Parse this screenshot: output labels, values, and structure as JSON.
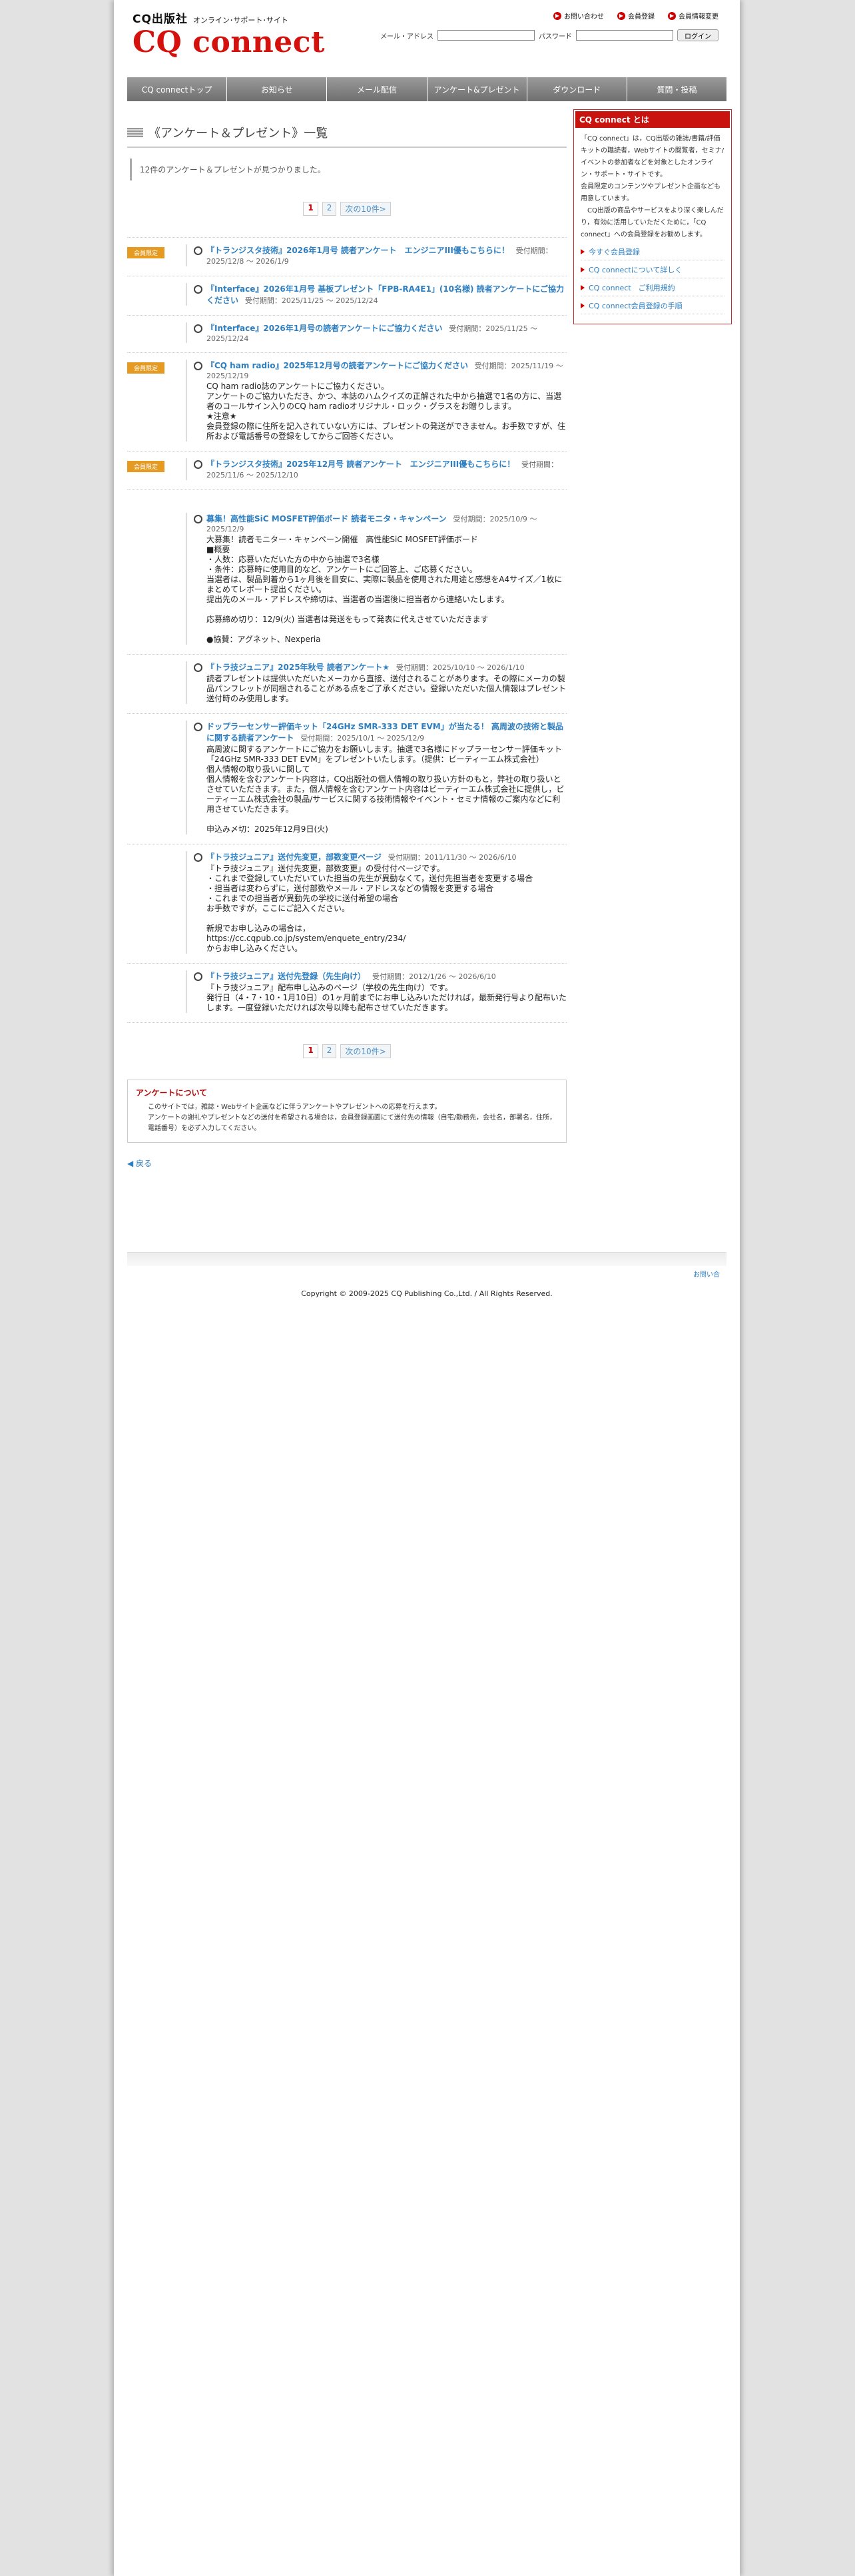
{
  "header": {
    "publisher": "CQ出版社",
    "subtitle": "オンライン･サポート･サイト",
    "logo": "CQ connect",
    "toplinks": [
      {
        "label": "お問い合わせ"
      },
      {
        "label": "会員登録"
      },
      {
        "label": "会員情報変更"
      }
    ],
    "login": {
      "email_label": "メール・アドレス",
      "password_label": "パスワード",
      "button_label": "ログイン"
    }
  },
  "nav": [
    {
      "label": "CQ connectトップ"
    },
    {
      "label": "お知らせ"
    },
    {
      "label": "メール配信"
    },
    {
      "label": "アンケート&プレゼント"
    },
    {
      "label": "ダウンロード"
    },
    {
      "label": "質問・投稿"
    }
  ],
  "page": {
    "title": "《アンケート＆プレゼント》一覧",
    "found_text": "12件のアンケート＆プレゼントが見つかりました。",
    "pager": {
      "current": "1",
      "other": "2",
      "next": "次の10件>"
    },
    "items": [
      {
        "badge": "会員限定",
        "title": "『トランジスタ技術』2026年1月号 読者アンケート　エンジニアIII優もこちらに！",
        "period": "受付期間：2025/12/8 ～ 2026/1/9",
        "desc": ""
      },
      {
        "badge": "",
        "title": "『Interface』2026年1月号 基板プレゼント「FPB-RA4E1」(10名様) 読者アンケートにご協力ください",
        "period": "受付期間：2025/11/25 ～ 2025/12/24",
        "desc": ""
      },
      {
        "badge": "",
        "title": "『Interface』2026年1月号の読者アンケートにご協力ください",
        "period": "受付期間：2025/11/25 ～ 2025/12/24",
        "desc": ""
      },
      {
        "badge": "会員限定",
        "title": "『CQ ham radio』2025年12月号の読者アンケートにご協力ください",
        "period": "受付期間：2025/11/19 ～ 2025/12/19",
        "desc": "CQ ham radio誌のアンケートにご協力ください。\nアンケートのご協力いただき、かつ、本誌のハムクイズの正解された中から抽選で1名の方に、当選者のコールサイン入りのCQ ham radioオリジナル・ロック・グラスをお贈りします。\n★注意★\n会員登録の際に住所を記入されていない方には、プレゼントの発送ができません。お手数ですが、住所および電話番号の登録をしてからご回答ください。"
      },
      {
        "badge": "会員限定",
        "title": "『トランジスタ技術』2025年12月号 読者アンケート　エンジニアIII優もこちらに！",
        "period": "受付期間：2025/11/6 ～ 2025/12/10",
        "desc": ""
      },
      {
        "badge": "",
        "title": "募集！高性能SiC MOSFET評価ボード 読者モニタ・キャンペーン",
        "period": "受付期間：2025/10/9 ～ 2025/12/9",
        "desc": "大募集！読者モニター・キャンペーン開催　高性能SiC MOSFET評価ボード\n■概要\n・人数：応募いただいた方の中から抽選で3名様\n・条件：応募時に使用目的など、アンケートにご回答上、ご応募ください。\n当選者は、製品到着から1ヶ月後を目安に、実際に製品を使用された用途と感想をA4サイズ／1枚にまとめてレポート提出ください。\n提出先のメール・アドレスや締切は、当選者の当選後に担当者から連絡いたします。\n\n応募締め切り：12/9(火) 当選者は発送をもって発表に代えさせていただきます\n\n●協賛：アグネット、Nexperia"
      },
      {
        "badge": "",
        "title": "『トラ技ジュニア』2025年秋号 読者アンケート★",
        "period": "受付期間：2025/10/10 ～ 2026/1/10",
        "desc": "読者プレゼントは提供いただいたメーカから直接、送付されることがあります。その際にメーカの製品パンフレットが同梱されることがある点をご了承ください。登録いただいた個人情報はプレゼント送付時のみ使用します。"
      },
      {
        "badge": "",
        "title": "ドップラーセンサー評価キット「24GHz SMR-333 DET EVM」が当たる！ 高周波の技術と製品に関する読者アンケート",
        "period": "受付期間：2025/10/1 ～ 2025/12/9",
        "desc": "高周波に関するアンケートにご協力をお願いします。抽選で3名様にドップラーセンサー評価キット「24GHz SMR-333 DET EVM」をプレゼントいたします。（提供：ビーティーエム株式会社）\n個人情報の取り扱いに関して\n個人情報を含むアンケート内容は，CQ出版社の個人情報の取り扱い方針のもと，弊社の取り扱いとさせていただきます。また，個人情報を含むアンケート内容はビーティーエム株式会社に提供し，ビーティーエム株式会社の製品/サービスに関する技術情報やイベント・セミナ情報のご案内などに利用させていただきます。\n\n申込み〆切：2025年12月9日(火)"
      },
      {
        "badge": "",
        "title": "『トラ技ジュニア』送付先変更，部数変更ページ",
        "period": "受付期間：2011/11/30 ～ 2026/6/10",
        "desc": "『トラ技ジュニア』送付先変更，部数変更」の受付付ページです。\n・これまで登録していただいていた担当の先生が異動なくて，送付先担当者を変更する場合\n・担当者は変わらずに，送付部数やメール・アドレスなどの情報を変更する場合\n・これまでの担当者が異動先の学校に送付希望の場合\nお手数ですが，ここにご記入ください。\n\n新規でお申し込みの場合は，\nhttps://cc.cqpub.co.jp/system/enquete_entry/234/\nからお申し込みください。"
      },
      {
        "badge": "",
        "title": "『トラ技ジュニア』送付先登録（先生向け）",
        "period": "受付期間：2012/1/26 ～ 2026/6/10",
        "desc": "『トラ技ジュニア』配布申し込みのページ（学校の先生向け）です。\n発行日（4・7・10・1月10日）の1ヶ月前までにお申し込みいただければ，最新発行号より配布いたします。一度登録いただければ次号以降も配布させていただきます。"
      }
    ],
    "about": {
      "heading": "アンケートについて",
      "lines": "このサイトでは，雑誌・Webサイト企画などに伴うアンケートやプレゼントへの応募を行えます。\nアンケートの謝礼やプレゼントなどの送付を希望される場合は，会員登録画面にて送付先の情報（自宅/勤務先，会社名，部署名，住所，電話番号）を必ず入力してください。"
    },
    "back": "戻る"
  },
  "sidebar": {
    "heading": "CQ connect とは",
    "text": "「CQ connect」は，CQ出版の雑誌/書籍/評価キットの職読者，Webサイトの閲覧者，セミナ/イベントの参加者などを対象としたオンライン・サポート・サイトです。\n会員限定のコンテンツやプレゼント企画なども用意しています。\n　CQ出版の商品やサービスをより深く楽しんだり，有効に活用していただくために，「CQ connect」への会員登録をお勧めします。",
    "links": [
      {
        "label": "今すぐ会員登録"
      },
      {
        "label": "CQ connectについて詳しく"
      },
      {
        "label": "CQ connect　ご利用規約"
      },
      {
        "label": "CQ connect会員登録の手順"
      }
    ]
  },
  "footer": {
    "link": "お問い合",
    "copyright": "Copyright © 2009-2025 CQ Publishing Co.,Ltd. / All Rights Reserved."
  }
}
